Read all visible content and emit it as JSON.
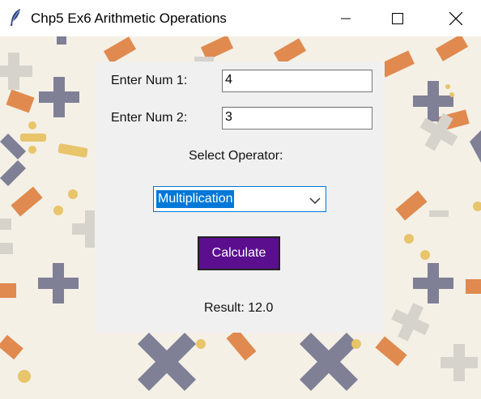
{
  "window": {
    "title": "Chp5 Ex6 Arithmetic Operations"
  },
  "form": {
    "num1_label": "Enter Num 1:",
    "num1_value": "4",
    "num2_label": "Enter Num 2:",
    "num2_value": "3",
    "operator_label": "Select Operator:",
    "operator_selected": "Multiplication",
    "calculate_label": "Calculate",
    "result_text": "Result: 12.0"
  },
  "colors": {
    "button_bg": "#5b0f8f",
    "select_highlight": "#0078d7",
    "panel_bg": "#f0f0f0"
  },
  "icons": [
    "feather-icon",
    "minimize-icon",
    "maximize-icon",
    "close-icon",
    "chevron-down-icon"
  ]
}
